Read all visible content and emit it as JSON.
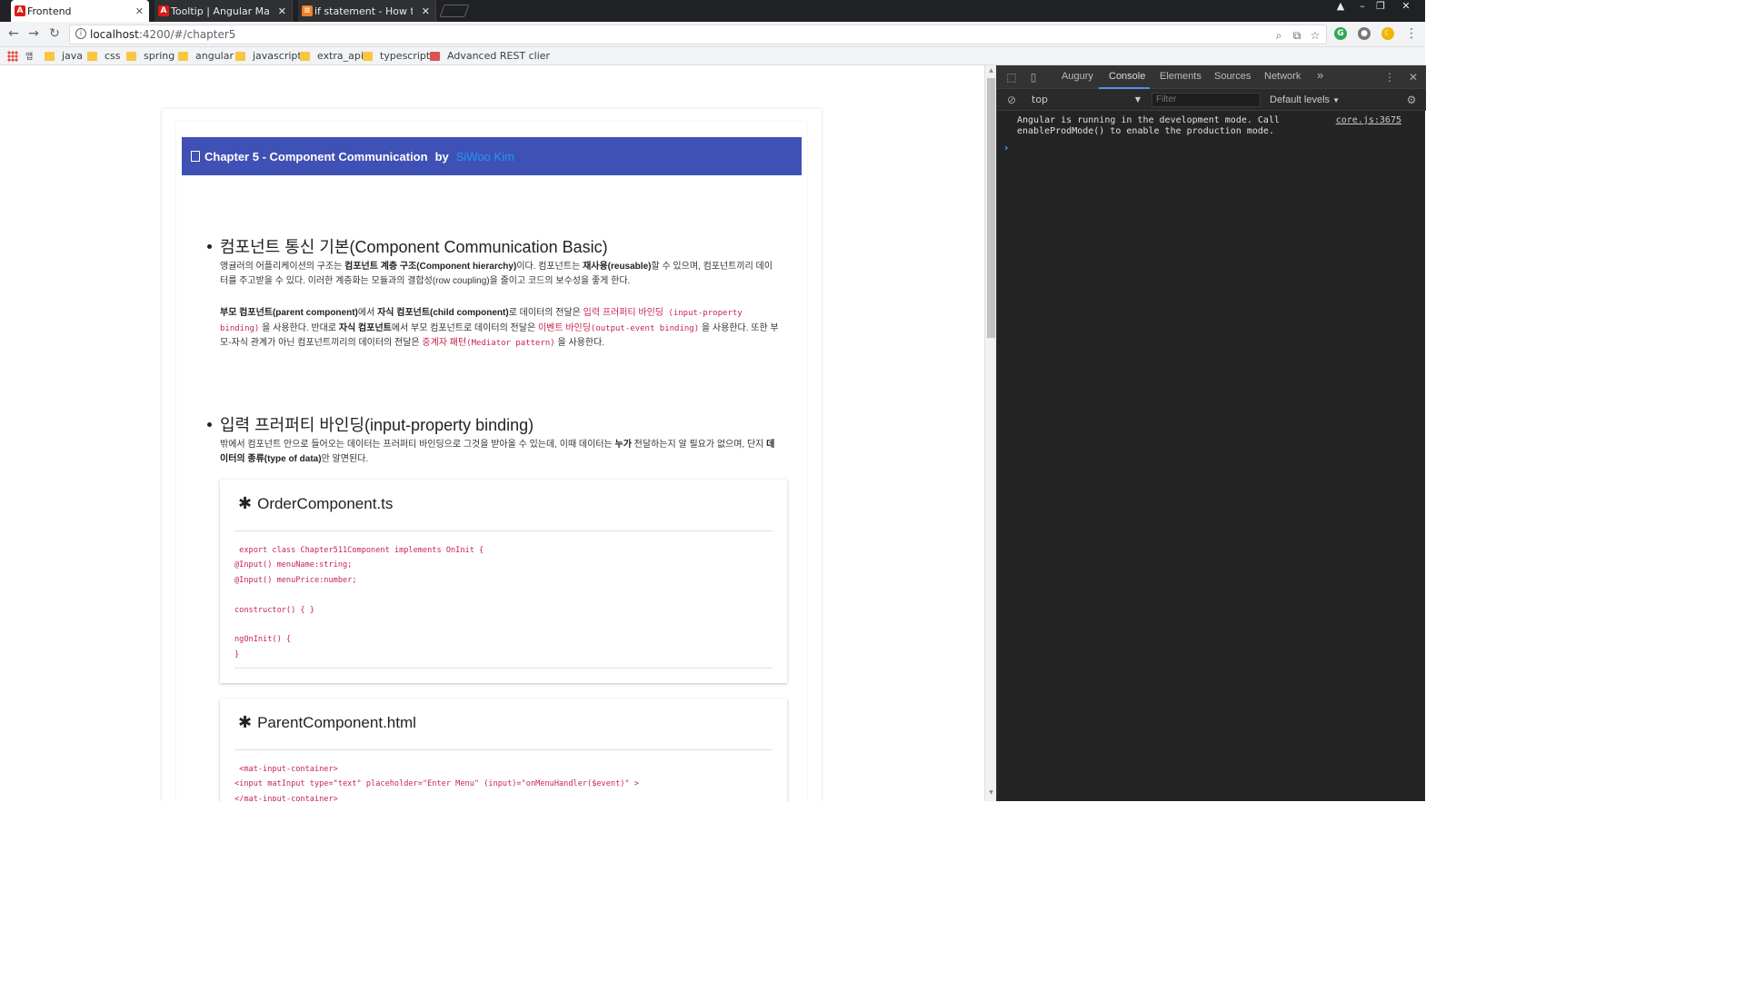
{
  "browser": {
    "tabs": [
      {
        "title": "Frontend",
        "icon": "angular-icon",
        "active": true
      },
      {
        "title": "Tooltip | Angular Materi",
        "icon": "angular-icon",
        "active": false
      },
      {
        "title": "if statement - How to u",
        "icon": "stackoverflow-icon",
        "active": false
      }
    ],
    "close_glyph": "✕",
    "url_host": "localhost",
    "url_rest": ":4200/#/chapter5",
    "bookmarks": [
      {
        "label": "java"
      },
      {
        "label": "css"
      },
      {
        "label": "spring"
      },
      {
        "label": "angular"
      },
      {
        "label": "javascript"
      },
      {
        "label": "extra_api"
      },
      {
        "label": "typescript"
      },
      {
        "label": "Advanced REST clier"
      }
    ],
    "apps_label": "앱"
  },
  "page": {
    "header": {
      "title": "Chapter 5 - Component Communication",
      "by": "by",
      "author": "SiWoo Kim"
    },
    "section1": {
      "title": "컴포넌트 통신 기본(Component Communication Basic)",
      "p1": [
        {
          "t": "앵귤러의 어플리케이션의 구조는 "
        },
        {
          "t": "컴포넌트 계층 구조(Component hierarchy)",
          "b": true
        },
        {
          "t": "이다. 컴포넌트는 "
        },
        {
          "t": "재사용(reusable)",
          "b": true
        },
        {
          "t": "할 수 있으며, 컴포넌트끼리 데이터를 주고받을 수 있다. 이러한 계층화는 모듈과의 결합성(row coupling)을 줄이고 코드의 보수성을 좋게 한다."
        }
      ],
      "p2": [
        {
          "t": "부모 컴포넌트(parent component)",
          "b": true
        },
        {
          "t": "에서 "
        },
        {
          "t": "자식 컴포넌트(child component)",
          "b": true
        },
        {
          "t": "로 데이터의 전달은 "
        },
        {
          "t": "입력 프러퍼티 바인딩",
          "k": true
        },
        {
          "t": " (input-property binding)",
          "c": true
        },
        {
          "t": " 을 사용한다. 반대로 "
        },
        {
          "t": "자식 컴포넌트",
          "b": true
        },
        {
          "t": "에서 부모 컴포넌트로 데이터의 전달은 "
        },
        {
          "t": "이벤트 바인딩",
          "k": true
        },
        {
          "t": "(output-event binding)",
          "c": true
        },
        {
          "t": " 을 사용한다. 또한 부모-자식 관계가 아닌 컴포넌트끼리의 데이터의 전달은 "
        },
        {
          "t": "중계자 패턴",
          "k": true
        },
        {
          "t": "(Mediator pattern)",
          "c": true
        },
        {
          "t": " 을 사용한다."
        }
      ]
    },
    "section2": {
      "title": "입력 프러퍼티 바인딩(input-property binding)",
      "p1": [
        {
          "t": "밖에서 컴포넌트 안으로 들어오는 데이터는 프러퍼티 바인딩으로 그것을 받아올 수 있는데, 이때 데이터는 "
        },
        {
          "t": "누가",
          "b": true
        },
        {
          "t": " 전달하는지 알 필요가 없으며, 단지 "
        },
        {
          "t": "데이터의 종류(type of data)",
          "b": true
        },
        {
          "t": "만 알면된다."
        }
      ]
    },
    "code_cards": [
      {
        "title": "OrderComponent.ts",
        "code": " export class Chapter511Component implements OnInit {\n@Input() menuName:string;\n@Input() menuPrice:number;\n\nconstructor() { }\n\nngOnInit() {\n}"
      },
      {
        "title": "ParentComponent.html",
        "code": " <mat-input-container>\n<input matInput type=\"text\" placeholder=\"Enter Menu\" (input)=\"onMenuHandler($event)\" >\n</mat-input-container>"
      }
    ]
  },
  "devtools": {
    "tabs": [
      "Augury",
      "Console",
      "Elements",
      "Sources",
      "Network"
    ],
    "active_tab": "Console",
    "more": "»",
    "context": "top",
    "filter_placeholder": "Filter",
    "levels": "Default levels",
    "message": "Angular is running in the development mode. Call enableProdMode() to enable the production mode.",
    "source": "core.js:3675",
    "prompt": "›"
  },
  "colors": {
    "header_bg": "#3f51b5",
    "author": "#2196f3",
    "code": "#c7254e",
    "devtools_bg": "#242424"
  }
}
